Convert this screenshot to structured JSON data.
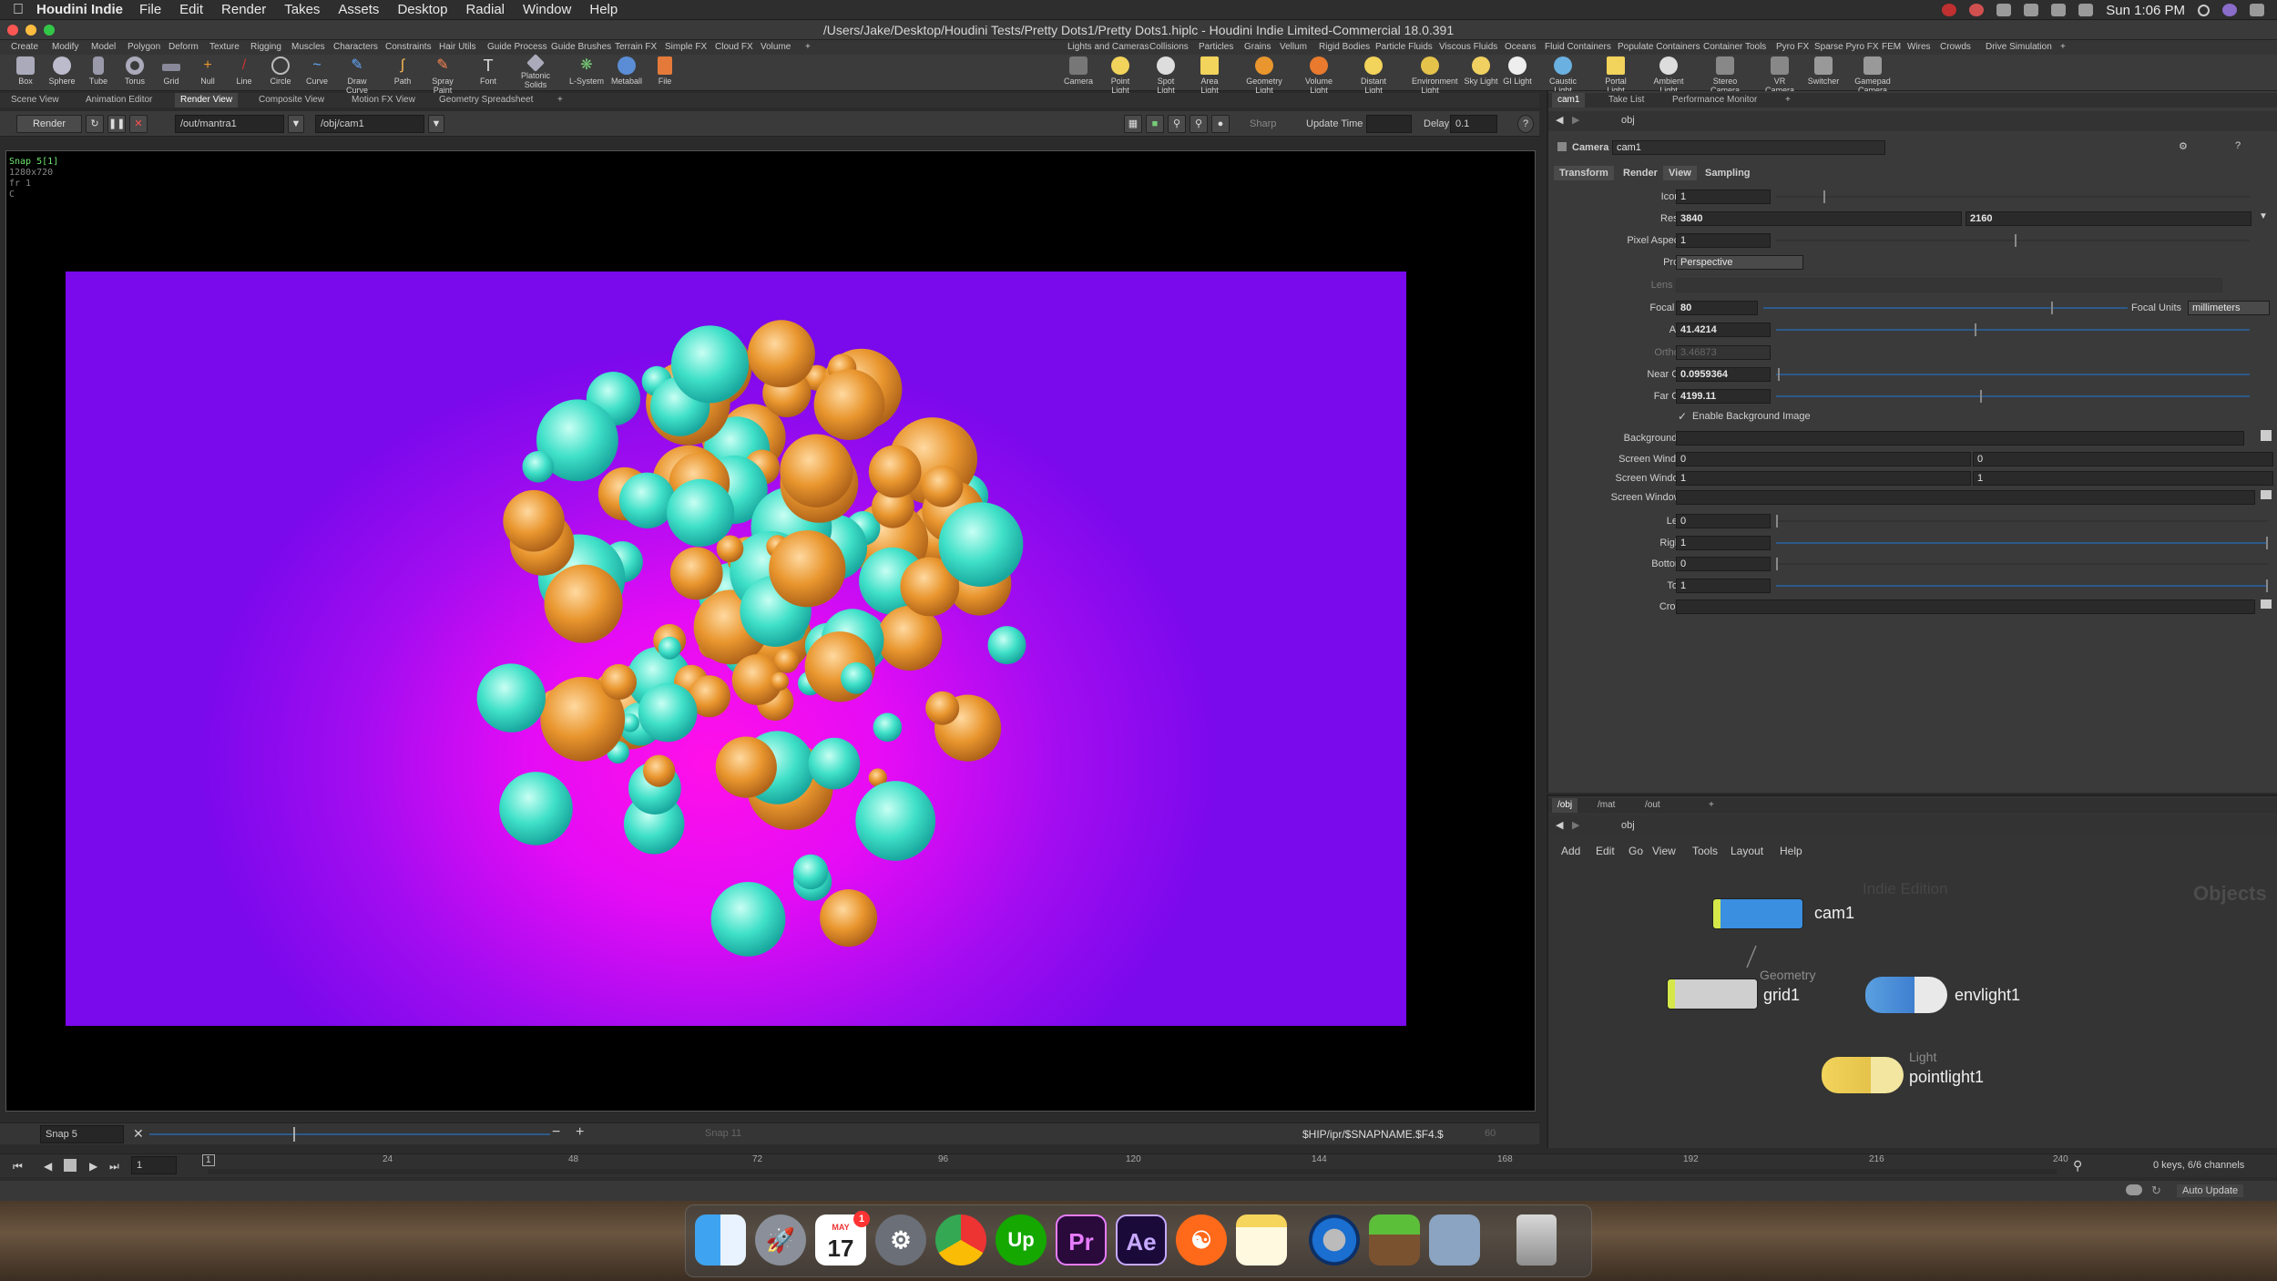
{
  "menubar": {
    "app_name": "Houdini Indie",
    "items": [
      "File",
      "Edit",
      "Render",
      "Takes",
      "Assets",
      "Desktop",
      "Radial",
      "Window",
      "Help"
    ],
    "clock": "Sun 1:06 PM"
  },
  "window": {
    "title": "/Users/Jake/Desktop/Houdini Tests/Pretty Dots1/Pretty Dots1.hiplc - Houdini Indie Limited-Commercial 18.0.391"
  },
  "shelf_tabs_left": [
    "Create",
    "Modify",
    "Model",
    "Polygon",
    "Deform",
    "Texture",
    "Rigging",
    "Muscles",
    "Characters",
    "Constraints",
    "Hair Utils",
    "Guide Process",
    "Guide Brushes",
    "Terrain FX",
    "Simple FX",
    "Cloud FX",
    "Volume"
  ],
  "shelf_tabs_right": [
    "Lights and Cameras",
    "Collisions",
    "Particles",
    "Grains",
    "Vellum",
    "Rigid Bodies",
    "Particle Fluids",
    "Viscous Fluids",
    "Oceans",
    "Fluid Containers",
    "Populate Containers",
    "Container Tools",
    "Pyro FX",
    "Sparse Pyro FX",
    "FEM",
    "Wires",
    "Crowds",
    "Drive Simulation"
  ],
  "shelf_tools_left": [
    "Box",
    "Sphere",
    "Tube",
    "Torus",
    "Grid",
    "Null",
    "Line",
    "Circle",
    "Curve",
    "Draw Curve",
    "Path",
    "Spray Paint",
    "Font",
    "Platonic Solids",
    "L-System",
    "Metaball",
    "File"
  ],
  "shelf_tools_right": [
    "Camera",
    "Point Light",
    "Spot Light",
    "Area Light",
    "Geometry Light",
    "Volume Light",
    "Distant Light",
    "Environment Light",
    "Sky Light",
    "GI Light",
    "Caustic Light",
    "Portal Light",
    "Ambient Light",
    "Stereo Camera",
    "VR Camera",
    "Switcher",
    "Gamepad Camera"
  ],
  "viewer_tabs": [
    "Scene View",
    "Animation Editor",
    "Render View",
    "Composite View",
    "Motion FX View",
    "Geometry Spreadsheet"
  ],
  "render_toolbar": {
    "render_label": "Render",
    "rop_path": "/out/mantra1",
    "camera_path": "/obj/cam1",
    "sharp_label": "Sharp",
    "update_time_label": "Update Time",
    "delay_label": "Delay",
    "delay_value": "0.1"
  },
  "render_info": {
    "snap": "Snap 5[1]",
    "res": "1280x720",
    "frame": "fr 1",
    "channel": "C"
  },
  "snap_bar": {
    "snap_name": "Snap 5",
    "snap_ref": "Snap 11",
    "output_path": "$HIP/ipr/$SNAPNAME.$F4.$",
    "count": "60"
  },
  "timeline": {
    "frame": "1",
    "start_marker": "1",
    "ticks": [
      "24",
      "48",
      "72",
      "96",
      "120",
      "144",
      "168",
      "192",
      "216",
      "240"
    ],
    "keys_info": "0 keys, 6/6 channels",
    "auto_update": "Auto Update"
  },
  "param_tabs": [
    "cam1",
    "Take List",
    "Performance Monitor"
  ],
  "param_path": "obj",
  "node_header": {
    "type": "Camera",
    "name": "cam1"
  },
  "param_subtabs": [
    "Transform",
    "Render",
    "View",
    "Sampling"
  ],
  "params": {
    "icon_scale": {
      "label": "Icon Scale",
      "value": "1"
    },
    "resolution": {
      "label": "Resolution",
      "x": "3840",
      "y": "2160"
    },
    "pixel_aspect": {
      "label": "Pixel Aspect Ratio",
      "value": "1"
    },
    "projection": {
      "label": "Projection",
      "value": "Perspective"
    },
    "lens_shader": {
      "label": "Lens Shader"
    },
    "focal_length": {
      "label": "Focal Length",
      "value": "80",
      "units_label": "Focal Units",
      "units": "millimeters"
    },
    "aperture": {
      "label": "Aperture",
      "value": "41.4214"
    },
    "ortho_width": {
      "label": "Ortho Width",
      "value": "3.46873"
    },
    "near_clipping": {
      "label": "Near Clipping",
      "value": "0.0959364"
    },
    "far_clipping": {
      "label": "Far Clipping",
      "value": "4199.11"
    },
    "enable_bg": {
      "label": "Enable Background Image"
    },
    "bg_image": {
      "label": "Background Image"
    },
    "screen_window_xy": {
      "label": "Screen Window X/Y",
      "x": "0",
      "y": "0"
    },
    "screen_window_size": {
      "label": "Screen Window Size",
      "x": "1",
      "y": "1"
    },
    "screen_window_mask": {
      "label": "Screen Window Mask"
    },
    "left_crop": {
      "label": "Left Crop",
      "value": "0"
    },
    "right_crop": {
      "label": "Right Crop",
      "value": "1"
    },
    "bottom_crop": {
      "label": "Bottom Crop",
      "value": "0"
    },
    "top_crop": {
      "label": "Top Crop",
      "value": "1"
    },
    "crop_mask": {
      "label": "Crop Mask"
    }
  },
  "net_tabs": [
    "/obj",
    "/mat",
    "/out"
  ],
  "net_path": "obj",
  "net_menu": [
    "Add",
    "Edit",
    "Go",
    "View",
    "Tools",
    "Layout",
    "Help"
  ],
  "net_watermark": "Indie Edition",
  "net_context": "Objects",
  "nodes": {
    "cam1": {
      "name": "cam1",
      "type": ""
    },
    "grid1": {
      "name": "grid1",
      "type": "Geometry"
    },
    "envlight1": {
      "name": "envlight1",
      "type": ""
    },
    "pointlight1": {
      "name": "pointlight1",
      "type": "Light"
    }
  },
  "dock": {
    "calendar_month": "MAY",
    "calendar_day": "17",
    "calendar_badge": "1",
    "premiere": "Pr",
    "after_effects": "Ae",
    "upwork": "Up"
  },
  "colors": {
    "render_magenta": "#ff10e8",
    "render_purple": "#7a09ec",
    "sphere_teal": "#3fe0c8",
    "sphere_orange": "#e9962e",
    "accent_blue": "#3f7fd0"
  }
}
